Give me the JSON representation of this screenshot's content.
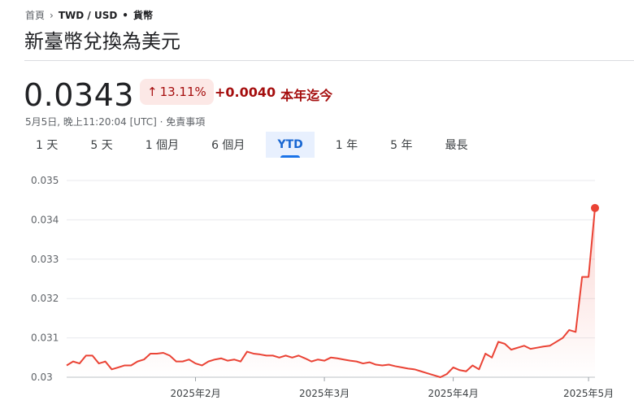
{
  "breadcrumb": {
    "home": "首頁",
    "pair": "TWD / USD",
    "dot": "•",
    "category": "貨幣"
  },
  "header": {
    "title": "新臺幣兌換為美元"
  },
  "quote": {
    "price": "0.0343",
    "percent": "13.11%",
    "change": "+0.0040",
    "period_label": "本年迄今",
    "meta": "5月5日, 晚上11:20:04 [UTC] · 免責事項"
  },
  "colors": {
    "line": "#ea4335",
    "down_text": "#a50e0e",
    "badge_bg": "#fce8e6",
    "tab_active": "#1a73e8"
  },
  "tabs": [
    {
      "label": "1 天"
    },
    {
      "label": "5 天"
    },
    {
      "label": "1 個月"
    },
    {
      "label": "6 個月"
    },
    {
      "label": "YTD"
    },
    {
      "label": "1 年"
    },
    {
      "label": "5 年"
    },
    {
      "label": "最長"
    }
  ],
  "active_tab": "YTD",
  "chart_data": {
    "type": "line",
    "ylim": [
      0.03,
      0.035
    ],
    "yticks": [
      "0.035",
      "0.034",
      "0.033",
      "0.032",
      "0.031",
      "0.03"
    ],
    "xticks": [
      "2025年2月",
      "2025年3月",
      "2025年4月",
      "2025年5月"
    ],
    "xtick_positions": [
      20,
      40,
      60,
      81
    ],
    "grid": true,
    "series": [
      {
        "values": [
          0.0303,
          0.0304,
          0.03035,
          0.03055,
          0.03055,
          0.03035,
          0.0304,
          0.0302,
          0.03025,
          0.0303,
          0.0303,
          0.0304,
          0.03045,
          0.0306,
          0.0306,
          0.03062,
          0.03055,
          0.0304,
          0.0304,
          0.03045,
          0.03035,
          0.0303,
          0.0304,
          0.03045,
          0.03048,
          0.03042,
          0.03045,
          0.0304,
          0.03065,
          0.0306,
          0.03058,
          0.03055,
          0.03055,
          0.0305,
          0.03055,
          0.0305,
          0.03055,
          0.03048,
          0.0304,
          0.03045,
          0.03042,
          0.0305,
          0.03048,
          0.03045,
          0.03042,
          0.0304,
          0.03035,
          0.03038,
          0.03032,
          0.0303,
          0.03032,
          0.03028,
          0.03025,
          0.03022,
          0.0302,
          0.03015,
          0.0301,
          0.03005,
          0.03,
          0.03008,
          0.03025,
          0.03018,
          0.03015,
          0.0303,
          0.0302,
          0.0306,
          0.0305,
          0.0309,
          0.03085,
          0.0307,
          0.03075,
          0.0308,
          0.03072,
          0.03075,
          0.03078,
          0.0308,
          0.0309,
          0.031,
          0.0312,
          0.03115,
          0.03255,
          0.03255,
          0.0343
        ]
      }
    ]
  }
}
